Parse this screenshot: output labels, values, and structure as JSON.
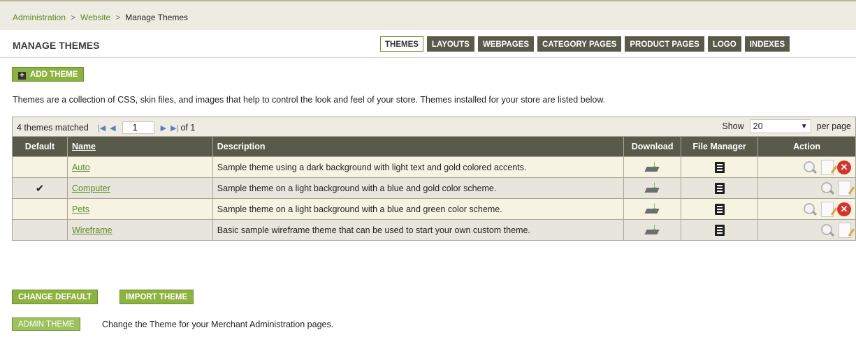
{
  "breadcrumb": {
    "item1": "Administration",
    "item2": "Website",
    "current": "Manage Themes",
    "separator": ">"
  },
  "page_title": "MANAGE THEMES",
  "tabs": [
    {
      "label": "THEMES",
      "active": true
    },
    {
      "label": "LAYOUTS"
    },
    {
      "label": "WEBPAGES"
    },
    {
      "label": "CATEGORY PAGES"
    },
    {
      "label": "PRODUCT PAGES"
    },
    {
      "label": "LOGO"
    },
    {
      "label": "INDEXES"
    }
  ],
  "add_theme_label": "ADD THEME",
  "intro_text": "Themes are a collection of CSS, skin files, and images that help to control the look and feel of your store. Themes installed for your store are listed below.",
  "pager": {
    "matched": "4 themes matched",
    "page": "1",
    "of": "of 1",
    "show_label": "Show",
    "per_page_value": "20",
    "per_page_label": "per page"
  },
  "columns": {
    "default": "Default",
    "name": "Name",
    "description": "Description",
    "download": "Download",
    "file_manager": "File Manager",
    "action": "Action"
  },
  "themes": [
    {
      "name": "Auto",
      "description": "Sample theme using a dark background with light text and gold colored accents.",
      "is_default": false,
      "can_delete": true
    },
    {
      "name": "Computer",
      "description": "Sample theme on a light background with a blue and gold color scheme.",
      "is_default": true,
      "can_delete": false
    },
    {
      "name": "Pets",
      "description": "Sample theme on a light background with a blue and green color scheme.",
      "is_default": false,
      "can_delete": true
    },
    {
      "name": "Wireframe",
      "description": "Basic sample wireframe theme that can be used to start your own custom theme.",
      "is_default": false,
      "can_delete": false
    }
  ],
  "checkmark": "✔",
  "change_default_label": "CHANGE DEFAULT",
  "import_theme_label": "IMPORT THEME",
  "admin_theme_label": "ADMIN THEME",
  "admin_theme_text": "Change the Theme for your Merchant Administration pages.",
  "colors": {
    "accent_green": "#8cb33f",
    "header_dark": "#5a5a4a",
    "link_green": "#5c8a27"
  }
}
